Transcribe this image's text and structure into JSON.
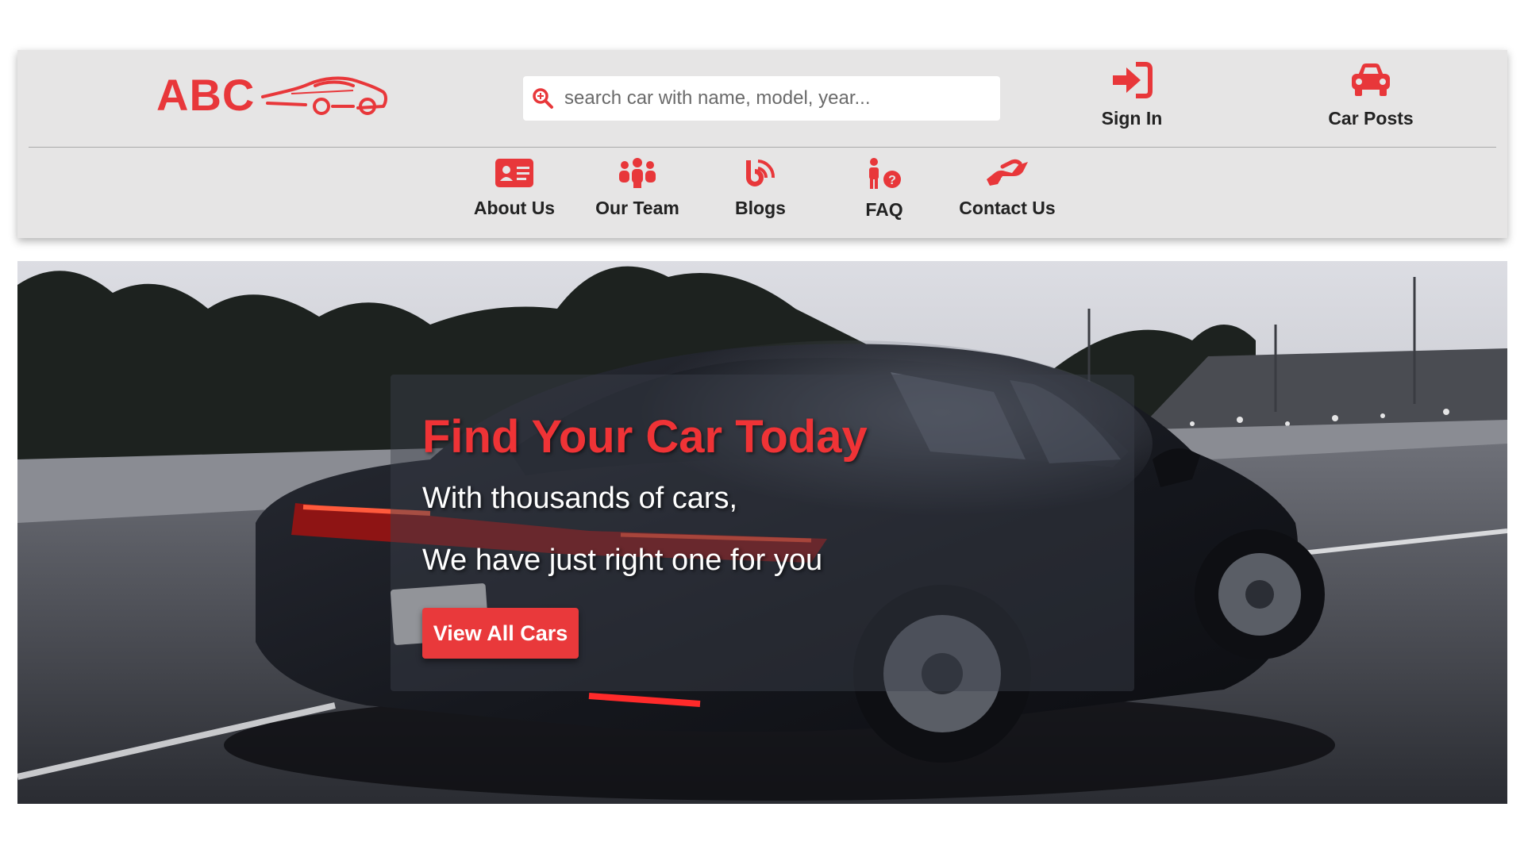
{
  "brand": {
    "name": "ABC",
    "accent_color": "#e8373a"
  },
  "search": {
    "placeholder": "search car with name, model, year...",
    "value": "",
    "icon": "search-icon"
  },
  "top_actions": [
    {
      "label": "Sign In",
      "icon": "sign-in-icon"
    },
    {
      "label": "Car Posts",
      "icon": "car-icon"
    }
  ],
  "nav": [
    {
      "label": "About Us",
      "icon": "id-card-icon"
    },
    {
      "label": "Our Team",
      "icon": "team-icon"
    },
    {
      "label": "Blogs",
      "icon": "blog-icon"
    },
    {
      "label": "FAQ",
      "icon": "faq-icon"
    },
    {
      "label": "Contact Us",
      "icon": "handshake-icon"
    }
  ],
  "hero": {
    "title": "Find Your Car Today",
    "line1": "With thousands of cars,",
    "line2": "We have just right one for you",
    "button_label": "View All Cars"
  }
}
